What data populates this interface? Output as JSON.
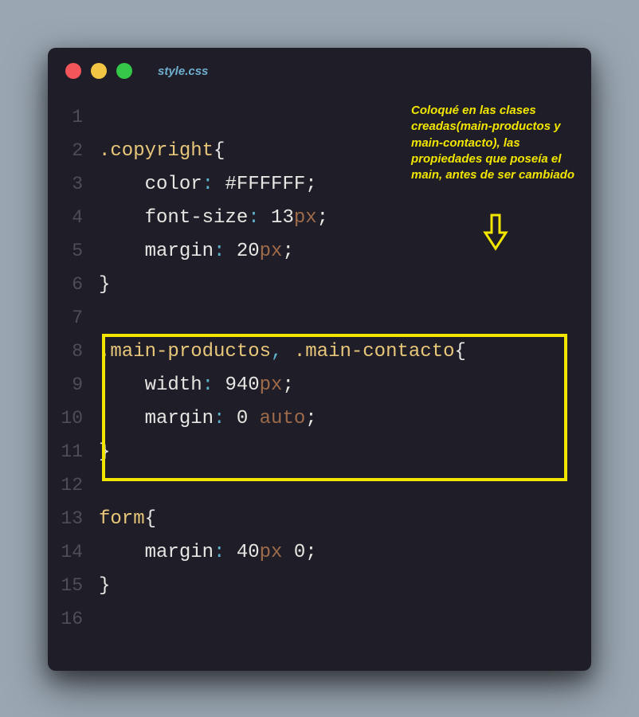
{
  "filename": "style.css",
  "annotation": "Coloqué en las clases creadas(main-productos y main-contacto), las propiedades que poseía el main, antes de ser cambiado",
  "linenos": [
    "1",
    "2",
    "3",
    "4",
    "5",
    "6",
    "7",
    "8",
    "9",
    "10",
    "11",
    "12",
    "13",
    "14",
    "15",
    "16"
  ],
  "code": {
    "sel_copyright": ".copyright",
    "prop_color": "color",
    "val_color": "#FFFFFF",
    "prop_fontsize": "font-size",
    "val_fontsize_num": "13",
    "val_fontsize_unit": "px",
    "prop_margin1": "margin",
    "val_margin1_num": "20",
    "val_margin1_unit": "px",
    "sel_main1": ".main-productos",
    "sel_main2": ".main-contacto",
    "prop_width": "width",
    "val_width_num": "940",
    "val_width_unit": "px",
    "prop_margin2": "margin",
    "val_margin2_a": "0",
    "val_margin2_b": "auto",
    "sel_form": "form",
    "prop_margin3": "margin",
    "val_margin3_a_num": "40",
    "val_margin3_a_unit": "px",
    "val_margin3_b": "0",
    "brace_open": "{",
    "brace_close": "}",
    "semi": ";",
    "colon": ":",
    "comma": ","
  }
}
